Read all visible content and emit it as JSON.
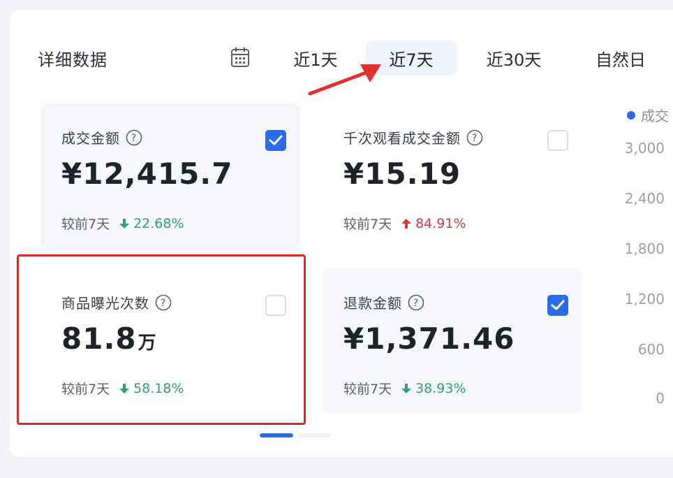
{
  "header": {
    "title": "详细数据",
    "tabs": [
      {
        "label": "近1天",
        "active": false
      },
      {
        "label": "近7天",
        "active": true
      },
      {
        "label": "近30天",
        "active": false
      },
      {
        "label": "自然日",
        "active": false
      }
    ]
  },
  "cards": [
    {
      "label": "成交金额",
      "value": "¥12,415.7",
      "unit": "",
      "compare_label": "较前7天",
      "change": "22.68%",
      "direction": "down",
      "checked": true
    },
    {
      "label": "千次观看成交金额",
      "value": "¥15.19",
      "unit": "",
      "compare_label": "较前7天",
      "change": "84.91%",
      "direction": "up",
      "checked": false
    },
    {
      "label": "商品曝光次数",
      "value": "81.8",
      "unit": "万",
      "compare_label": "较前7天",
      "change": "58.18%",
      "direction": "down",
      "checked": false
    },
    {
      "label": "退款金额",
      "value": "¥1,371.46",
      "unit": "",
      "compare_label": "较前7天",
      "change": "38.93%",
      "direction": "down",
      "checked": true
    }
  ],
  "chart": {
    "legend": "成交",
    "y_ticks": [
      "3,000",
      "2,400",
      "1,800",
      "1,200",
      "600",
      "0"
    ]
  },
  "colors": {
    "accent": "#2b6be6",
    "down": "#2aa56b",
    "up": "#d9363e",
    "highlight": "#d8262a"
  },
  "pager": {
    "active_index": 0,
    "count": 2
  }
}
